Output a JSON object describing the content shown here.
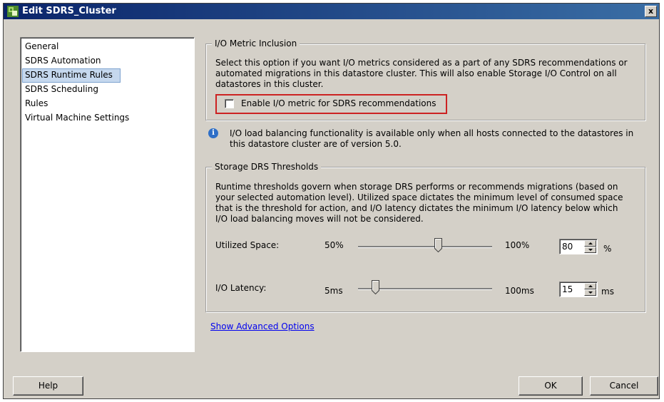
{
  "window": {
    "title": "Edit SDRS_Cluster",
    "close_label": "x"
  },
  "nav": {
    "items": [
      {
        "label": "General",
        "selected": false
      },
      {
        "label": "SDRS Automation",
        "selected": false
      },
      {
        "label": "SDRS Runtime Rules",
        "selected": true
      },
      {
        "label": "SDRS Scheduling",
        "selected": false
      },
      {
        "label": "Rules",
        "selected": false
      },
      {
        "label": "Virtual Machine Settings",
        "selected": false
      }
    ]
  },
  "io_metric": {
    "legend": "I/O Metric Inclusion",
    "description": "Select this option if you want I/O metrics considered as a part of any SDRS recommendations or automated migrations in this datastore cluster. This will also enable Storage I/O Control on all datastores in this cluster.",
    "checkbox_label": "Enable I/O metric for SDRS recommendations",
    "checked": false,
    "highlight_color": "#cc2222"
  },
  "info": {
    "icon": "info-icon",
    "text": "I/O load balancing functionality is available only when all hosts connected to the datastores in this datastore cluster are of version 5.0."
  },
  "thresholds": {
    "legend": "Storage DRS Thresholds",
    "description": "Runtime thresholds govern when storage DRS performs or recommends migrations (based on your selected automation level). Utilized space dictates the minimum level of consumed space that is the threshold for action, and I/O latency dictates the minimum I/O latency below which I/O load balancing moves will not be considered.",
    "utilized": {
      "label": "Utilized Space:",
      "min": "50%",
      "max": "100%",
      "value": "80",
      "unit": "%",
      "level": 0.6
    },
    "latency": {
      "label": "I/O Latency:",
      "min": "5ms",
      "max": "100ms",
      "value": "15",
      "unit": "ms",
      "level": 0.105
    }
  },
  "advanced_link": "Show Advanced Options",
  "buttons": {
    "help": "Help",
    "ok": "OK",
    "cancel": "Cancel"
  }
}
